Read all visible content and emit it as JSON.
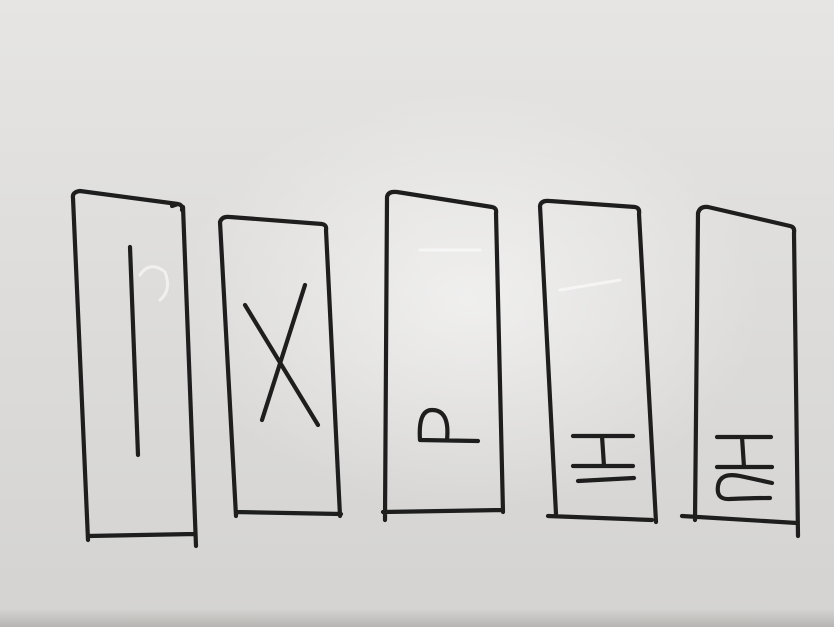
{
  "whiteboard": {
    "cards": [
      {
        "id": "card-1",
        "glyph": "I"
      },
      {
        "id": "card-2",
        "glyph": "X"
      },
      {
        "id": "card-3",
        "glyph": "P"
      },
      {
        "id": "card-4",
        "glyph": "H1"
      },
      {
        "id": "card-5",
        "glyph": "H2"
      }
    ],
    "colors": {
      "board": "#e2e1df",
      "ink": "#1e1e1e"
    }
  }
}
